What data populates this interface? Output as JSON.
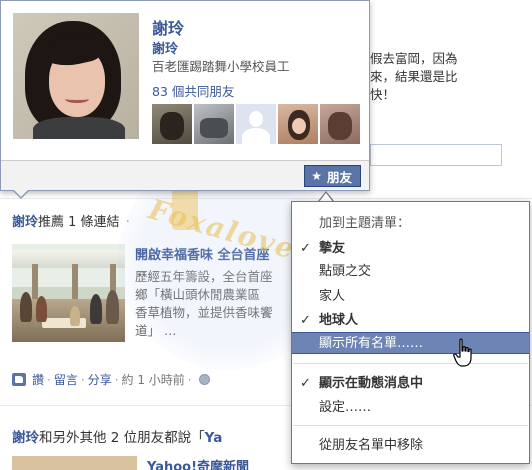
{
  "hovercard": {
    "name": "謝玲",
    "alt_name": "謝玲",
    "workplace": "百老匯踢踏舞小學校員工",
    "mutual_friends": "83 個共同朋友",
    "friends_button": "朋友",
    "star_icon": "★"
  },
  "background_post": {
    "text_lines": [
      "假去富岡，因為",
      "來，結果還是比",
      "快！"
    ]
  },
  "post": {
    "author": "謝玲",
    "action": "推薦 1 條連結",
    "dot": "·",
    "link_title": "開啟幸福香味 全台首座",
    "link_desc_lines": [
      "歷經五年籌設，全台首座",
      "鄉「橫山頭休閒農業區",
      "香草植物，並提供香味饗",
      "道」 …"
    ],
    "actions": {
      "like": "讚",
      "comment": "留言",
      "share": "分享",
      "time": "約 1 小時前",
      "sep": "·"
    }
  },
  "story2": {
    "author": "謝玲",
    "text": "和另外其他 2 位朋友都說「",
    "quote_start": "Ya",
    "link_title": "Yahoo!奇摩新聞"
  },
  "watermark": {
    "text": "Foxalove.tw"
  },
  "friends_menu": {
    "header": "加到主題清單：",
    "items": [
      {
        "label": "摯友",
        "checked": true,
        "bold": true
      },
      {
        "label": "點頭之交",
        "checked": false,
        "bold": false
      },
      {
        "label": "家人",
        "checked": false,
        "bold": false
      },
      {
        "label": "地球人",
        "checked": true,
        "bold": true
      },
      {
        "label": "顯示所有名單……",
        "checked": false,
        "bold": false,
        "highlighted": true
      }
    ],
    "show_in_feed": "顯示在動態消息中",
    "settings": "設定……",
    "remove": "從朋友名單中移除",
    "check_mark": "✓"
  },
  "colors": {
    "link_blue": "#3b5998",
    "button_blue": "#5b74a8",
    "highlight": "#6d84b4"
  }
}
